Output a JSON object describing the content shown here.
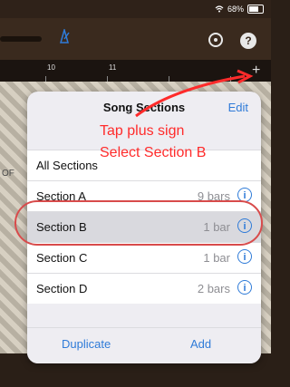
{
  "status": {
    "battery_text": "68%",
    "battery_level": 0.68
  },
  "toolbar": {
    "settings_icon": "settings-clock-icon",
    "help_label": "?"
  },
  "ruler": {
    "numbers": [
      "10",
      "11"
    ]
  },
  "background": {
    "left_partial_text": "OF"
  },
  "popover": {
    "title": "Song Sections",
    "edit_label": "Edit",
    "rows": [
      {
        "label": "All Sections",
        "bars": ""
      },
      {
        "label": "Section A",
        "bars": "9 bars"
      },
      {
        "label": "Section B",
        "bars": "1 bar"
      },
      {
        "label": "Section C",
        "bars": "1 bar"
      },
      {
        "label": "Section D",
        "bars": "2 bars"
      }
    ],
    "footer": {
      "duplicate_label": "Duplicate",
      "add_label": "Add"
    }
  },
  "annotations": {
    "line1": "Tap plus sign",
    "line2": "Select Section B",
    "color": "#ff2b2b"
  },
  "colors": {
    "accent": "#2f7bd8"
  }
}
